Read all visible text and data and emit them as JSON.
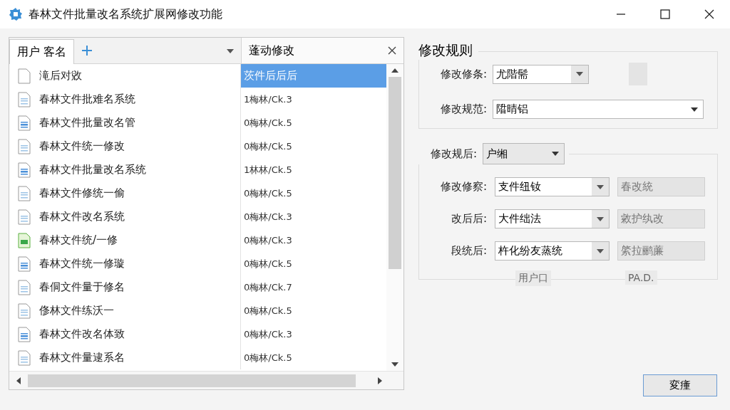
{
  "window": {
    "title": "春林文件批量改名系统扩展网修改功能"
  },
  "list_panel": {
    "tab": {
      "label": "用户 客名",
      "selected": true
    },
    "column_header": "蓬动修改",
    "rows": [
      {
        "name": "滝后对敓",
        "value": "茨件后后后",
        "kind": "plain",
        "selected": true
      },
      {
        "name": "春林文件批难名系统",
        "value": "1梅林/Ck.3",
        "kind": "doc",
        "selected": false
      },
      {
        "name": "春林文件批量改名管",
        "value": "0梅林/Ck.5",
        "kind": "doc-blue",
        "selected": false
      },
      {
        "name": "春林文件统一修改",
        "value": "0梅林/Ck.5",
        "kind": "doc",
        "selected": false
      },
      {
        "name": "春林文件批量改名系统",
        "value": "1林林/Ck.5",
        "kind": "doc-blue",
        "selected": false
      },
      {
        "name": "春林文件修统一偷",
        "value": "0梅林/Ck.5",
        "kind": "doc",
        "selected": false
      },
      {
        "name": "春林文件改名系统",
        "value": "0梅林/Ck.3",
        "kind": "doc",
        "selected": false
      },
      {
        "name": "春林文件统/一修",
        "value": "0梅林/Ck.3",
        "kind": "sheet",
        "selected": false
      },
      {
        "name": "春林文件统一修璇",
        "value": "0梅林/Ck.5",
        "kind": "doc-blue",
        "selected": false
      },
      {
        "name": "春侗文件量于修名",
        "value": "0梅林/Ck.7",
        "kind": "doc",
        "selected": false
      },
      {
        "name": "俢林文件练沃一",
        "value": "0梅林/Ck.5",
        "kind": "doc",
        "selected": false
      },
      {
        "name": "春林文件改名体致",
        "value": "0梅林/Ck.3",
        "kind": "doc-blue",
        "selected": false
      },
      {
        "name": "春林文件量逮系名",
        "value": "0梅林/Ck.5",
        "kind": "doc",
        "selected": false
      }
    ]
  },
  "rules": {
    "title": "修改规则",
    "rule_type": {
      "label": "修改修条:",
      "value": "尤階髵"
    },
    "rule_spec": {
      "label": "修改规范:",
      "value": "陹晴铝"
    }
  },
  "after": {
    "label": "修改规后:",
    "value": "户缃",
    "rows": [
      {
        "label": "修改修察:",
        "value": "支件纽钕",
        "field": "春改統"
      },
      {
        "label": "改后后:",
        "value": "大件绌法",
        "field": "敹护纨改"
      },
      {
        "label": "段统后:",
        "value": "杵化纷友蒸统",
        "field": "綮拉鹂薕"
      }
    ],
    "footer_left": "用户口",
    "footer_right": "PA.D."
  },
  "buttons": [
    "変瘇"
  ]
}
